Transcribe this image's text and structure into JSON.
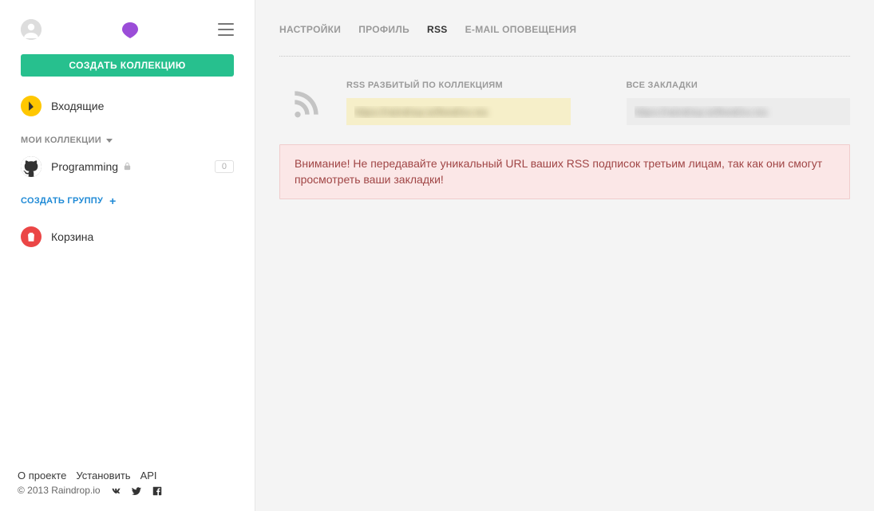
{
  "sidebar": {
    "create_collection_label": "СОЗДАТЬ КОЛЛЕКЦИЮ",
    "inbox_label": "Входящие",
    "group_header": "МОИ КОЛЛЕКЦИИ",
    "collections": [
      {
        "name": "Programming",
        "count": "0"
      }
    ],
    "create_group_label": "СОЗДАТЬ ГРУППУ",
    "trash_label": "Корзина"
  },
  "footer": {
    "about": "О проекте",
    "install": "Установить",
    "api": "API",
    "copyright": "© 2013 Raindrop.io"
  },
  "tabs": {
    "settings": "НАСТРОЙКИ",
    "profile": "ПРОФИЛЬ",
    "rss": "RSS",
    "email_notify": "E-MAIL ОПОВЕЩЕНИЯ"
  },
  "rss": {
    "by_collections_label": "RSS РАЗБИТЫЙ ПО КОЛЛЕКЦИЯМ",
    "all_bookmarks_label": "ВСЕ ЗАКЛАДКИ",
    "url_collections": "https://raindrop.io/feed/xx.rss",
    "url_all": "https://raindrop.io/feed/xx.rss"
  },
  "warning_text": "Внимание! Не передавайте уникальный URL ваших RSS подписок третьим лицам, так как они смогут просмотреть ваши закладки!"
}
